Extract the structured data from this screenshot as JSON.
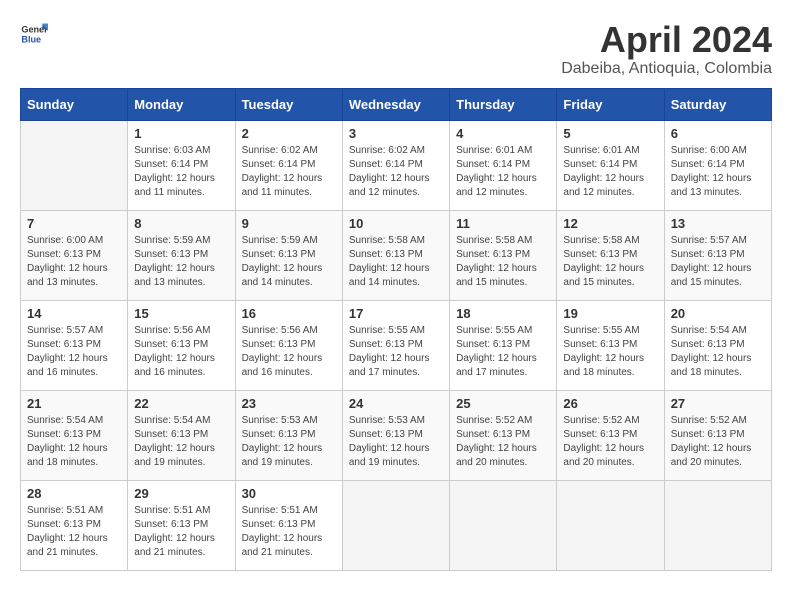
{
  "header": {
    "logo": {
      "general": "General",
      "blue": "Blue"
    },
    "title": "April 2024",
    "location": "Dabeiba, Antioquia, Colombia"
  },
  "calendar": {
    "weekdays": [
      "Sunday",
      "Monday",
      "Tuesday",
      "Wednesday",
      "Thursday",
      "Friday",
      "Saturday"
    ],
    "weeks": [
      [
        {
          "day": "",
          "info": ""
        },
        {
          "day": "1",
          "info": "Sunrise: 6:03 AM\nSunset: 6:14 PM\nDaylight: 12 hours\nand 11 minutes."
        },
        {
          "day": "2",
          "info": "Sunrise: 6:02 AM\nSunset: 6:14 PM\nDaylight: 12 hours\nand 11 minutes."
        },
        {
          "day": "3",
          "info": "Sunrise: 6:02 AM\nSunset: 6:14 PM\nDaylight: 12 hours\nand 12 minutes."
        },
        {
          "day": "4",
          "info": "Sunrise: 6:01 AM\nSunset: 6:14 PM\nDaylight: 12 hours\nand 12 minutes."
        },
        {
          "day": "5",
          "info": "Sunrise: 6:01 AM\nSunset: 6:14 PM\nDaylight: 12 hours\nand 12 minutes."
        },
        {
          "day": "6",
          "info": "Sunrise: 6:00 AM\nSunset: 6:14 PM\nDaylight: 12 hours\nand 13 minutes."
        }
      ],
      [
        {
          "day": "7",
          "info": "Sunrise: 6:00 AM\nSunset: 6:13 PM\nDaylight: 12 hours\nand 13 minutes."
        },
        {
          "day": "8",
          "info": "Sunrise: 5:59 AM\nSunset: 6:13 PM\nDaylight: 12 hours\nand 13 minutes."
        },
        {
          "day": "9",
          "info": "Sunrise: 5:59 AM\nSunset: 6:13 PM\nDaylight: 12 hours\nand 14 minutes."
        },
        {
          "day": "10",
          "info": "Sunrise: 5:58 AM\nSunset: 6:13 PM\nDaylight: 12 hours\nand 14 minutes."
        },
        {
          "day": "11",
          "info": "Sunrise: 5:58 AM\nSunset: 6:13 PM\nDaylight: 12 hours\nand 15 minutes."
        },
        {
          "day": "12",
          "info": "Sunrise: 5:58 AM\nSunset: 6:13 PM\nDaylight: 12 hours\nand 15 minutes."
        },
        {
          "day": "13",
          "info": "Sunrise: 5:57 AM\nSunset: 6:13 PM\nDaylight: 12 hours\nand 15 minutes."
        }
      ],
      [
        {
          "day": "14",
          "info": "Sunrise: 5:57 AM\nSunset: 6:13 PM\nDaylight: 12 hours\nand 16 minutes."
        },
        {
          "day": "15",
          "info": "Sunrise: 5:56 AM\nSunset: 6:13 PM\nDaylight: 12 hours\nand 16 minutes."
        },
        {
          "day": "16",
          "info": "Sunrise: 5:56 AM\nSunset: 6:13 PM\nDaylight: 12 hours\nand 16 minutes."
        },
        {
          "day": "17",
          "info": "Sunrise: 5:55 AM\nSunset: 6:13 PM\nDaylight: 12 hours\nand 17 minutes."
        },
        {
          "day": "18",
          "info": "Sunrise: 5:55 AM\nSunset: 6:13 PM\nDaylight: 12 hours\nand 17 minutes."
        },
        {
          "day": "19",
          "info": "Sunrise: 5:55 AM\nSunset: 6:13 PM\nDaylight: 12 hours\nand 18 minutes."
        },
        {
          "day": "20",
          "info": "Sunrise: 5:54 AM\nSunset: 6:13 PM\nDaylight: 12 hours\nand 18 minutes."
        }
      ],
      [
        {
          "day": "21",
          "info": "Sunrise: 5:54 AM\nSunset: 6:13 PM\nDaylight: 12 hours\nand 18 minutes."
        },
        {
          "day": "22",
          "info": "Sunrise: 5:54 AM\nSunset: 6:13 PM\nDaylight: 12 hours\nand 19 minutes."
        },
        {
          "day": "23",
          "info": "Sunrise: 5:53 AM\nSunset: 6:13 PM\nDaylight: 12 hours\nand 19 minutes."
        },
        {
          "day": "24",
          "info": "Sunrise: 5:53 AM\nSunset: 6:13 PM\nDaylight: 12 hours\nand 19 minutes."
        },
        {
          "day": "25",
          "info": "Sunrise: 5:52 AM\nSunset: 6:13 PM\nDaylight: 12 hours\nand 20 minutes."
        },
        {
          "day": "26",
          "info": "Sunrise: 5:52 AM\nSunset: 6:13 PM\nDaylight: 12 hours\nand 20 minutes."
        },
        {
          "day": "27",
          "info": "Sunrise: 5:52 AM\nSunset: 6:13 PM\nDaylight: 12 hours\nand 20 minutes."
        }
      ],
      [
        {
          "day": "28",
          "info": "Sunrise: 5:51 AM\nSunset: 6:13 PM\nDaylight: 12 hours\nand 21 minutes."
        },
        {
          "day": "29",
          "info": "Sunrise: 5:51 AM\nSunset: 6:13 PM\nDaylight: 12 hours\nand 21 minutes."
        },
        {
          "day": "30",
          "info": "Sunrise: 5:51 AM\nSunset: 6:13 PM\nDaylight: 12 hours\nand 21 minutes."
        },
        {
          "day": "",
          "info": ""
        },
        {
          "day": "",
          "info": ""
        },
        {
          "day": "",
          "info": ""
        },
        {
          "day": "",
          "info": ""
        }
      ]
    ]
  }
}
